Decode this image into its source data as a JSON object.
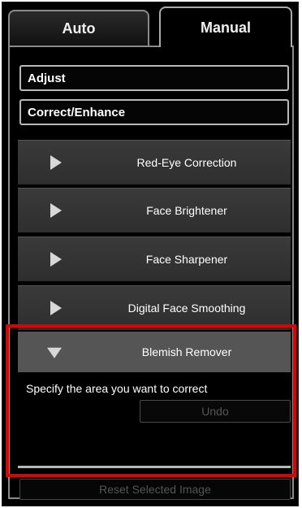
{
  "tabs": {
    "auto": "Auto",
    "manual": "Manual"
  },
  "sections": {
    "adjust": "Adjust",
    "correct_enhance": "Correct/Enhance"
  },
  "items": [
    {
      "label": "Red-Eye Correction"
    },
    {
      "label": "Face Brightener"
    },
    {
      "label": "Face Sharpener"
    },
    {
      "label": "Digital Face Smoothing"
    }
  ],
  "blemish": {
    "label": "Blemish Remover",
    "instruction": "Specify the area you want to correct",
    "undo": "Undo"
  },
  "reset_label": "Reset Selected Image",
  "colors": {
    "highlight": "#e00000",
    "background": "#000000",
    "expanded_header": "#555555"
  },
  "icons": {
    "collapsed": "triangle-right-icon",
    "expanded": "triangle-down-icon"
  }
}
